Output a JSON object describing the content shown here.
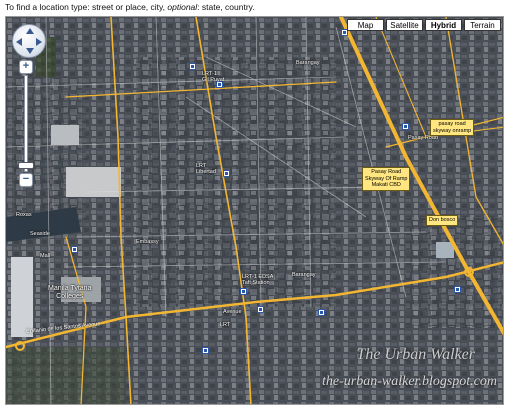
{
  "hint": {
    "prefix": "To find a location type: street or place, city,",
    "optional": "optional",
    "suffix": ": state, country."
  },
  "map_types": [
    "Map",
    "Satellite",
    "Hybrid",
    "Terrain"
  ],
  "active_map_type": "Hybrid",
  "callouts": {
    "pasay_road_1": [
      "pasay road",
      "skyway onramp"
    ],
    "pasay_road_2": [
      "Pasay Road",
      "Skyway Of Ramp",
      "Makati CBD"
    ],
    "don_bosco": [
      "Don bosco"
    ]
  },
  "road_labels": {
    "edsa": "Epifanio de los Santos Avenue"
  },
  "place_labels": {
    "manila_tytana": [
      "Manila Tytana",
      "Colleges"
    ],
    "lrt_edsa": [
      "LRT-1 EDSA",
      "Taft Station"
    ],
    "embassy": "Embassy",
    "lrt_top": "LRT-1",
    "lrt_mid": "LRT",
    "lrt_bottom": "LRT",
    "gil_puyat": "Gil Puyat",
    "libertad": "Libertad",
    "pasay_road_lbl": "Pasay Road",
    "barangay_a": "Barangay",
    "barangay_b": "Barangay",
    "avenue": "Avenue",
    "seaside": "Seaside",
    "roxas": "Roxas",
    "mall": "Mall"
  },
  "watermark": {
    "line1": "The Urban Walker",
    "line2": "the-urban-walker.blogspot.com"
  },
  "colors": {
    "highway": "#f2b632",
    "callout_bg": "#ffe680",
    "marker": "#2b57a8"
  }
}
